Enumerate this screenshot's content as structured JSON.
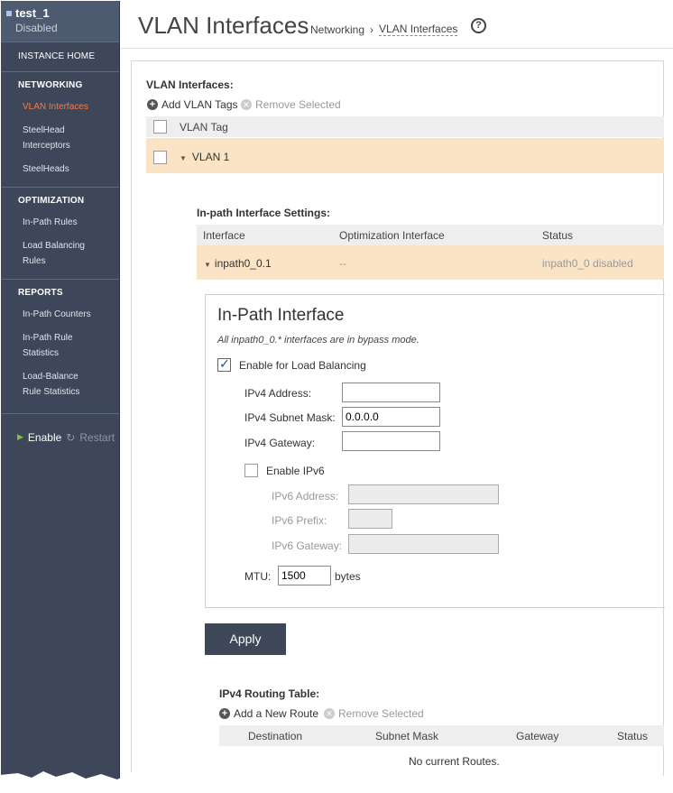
{
  "sidebar": {
    "instance_name": "test_1",
    "instance_status": "Disabled",
    "home": "INSTANCE HOME",
    "sections": [
      {
        "title": "NETWORKING",
        "items": [
          "VLAN Interfaces",
          "SteelHead Interceptors",
          "SteelHeads"
        ]
      },
      {
        "title": "OPTIMIZATION",
        "items": [
          "In-Path Rules",
          "Load Balancing Rules"
        ]
      },
      {
        "title": "REPORTS",
        "items": [
          "In-Path Counters",
          "In-Path Rule Statistics",
          "Load-Balance Rule Statistics"
        ]
      }
    ],
    "enable": "Enable",
    "restart": "Restart"
  },
  "header": {
    "title": "VLAN Interfaces",
    "breadcrumb": [
      "Networking",
      "VLAN Interfaces"
    ],
    "help": "?"
  },
  "vlan": {
    "section_title": "VLAN Interfaces:",
    "add_label": "Add VLAN Tags",
    "remove_label": "Remove Selected",
    "column": "VLAN Tag",
    "rows": [
      "VLAN 1"
    ]
  },
  "inpath_settings": {
    "title": "In-path Interface Settings:",
    "columns": [
      "Interface",
      "Optimization Interface",
      "Status"
    ],
    "row": {
      "interface": "inpath0_0.1",
      "optimization": "--",
      "status": "inpath0_0 disabled"
    }
  },
  "inpath_form": {
    "title": "In-Path Interface",
    "note": "All inpath0_0.* interfaces are in bypass mode.",
    "enable_lb": "Enable for Load Balancing",
    "enable_lb_checked": true,
    "ipv4_address_label": "IPv4 Address:",
    "ipv4_address": "",
    "ipv4_mask_label": "IPv4 Subnet Mask:",
    "ipv4_mask": "0.0.0.0",
    "ipv4_gateway_label": "IPv4 Gateway:",
    "ipv4_gateway": "",
    "enable_ipv6": "Enable IPv6",
    "enable_ipv6_checked": false,
    "ipv6_address_label": "IPv6 Address:",
    "ipv6_prefix_label": "IPv6 Prefix:",
    "ipv6_gateway_label": "IPv6 Gateway:",
    "mtu_label": "MTU:",
    "mtu": "1500",
    "mtu_unit": "bytes",
    "apply": "Apply"
  },
  "routing": {
    "title": "IPv4 Routing Table:",
    "add_label": "Add a New Route",
    "remove_label": "Remove Selected",
    "columns": [
      "Destination",
      "Subnet Mask",
      "Gateway",
      "Status"
    ],
    "empty": "No current Routes."
  }
}
